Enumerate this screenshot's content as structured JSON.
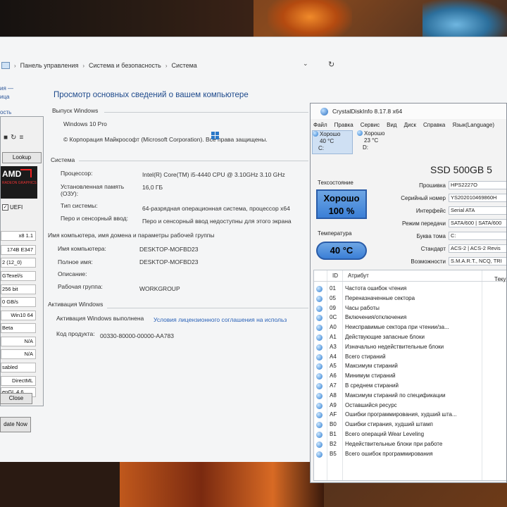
{
  "breadcrumb": [
    "Панель управления",
    "Система и безопасность",
    "Система"
  ],
  "nav_fragments": [
    "ия —",
    "ица",
    "ость"
  ],
  "system": {
    "title": "Просмотр основных сведений о вашем компьютере",
    "edition_header": "Выпуск Windows",
    "edition": "Windows 10 Pro",
    "copyright": "© Корпорация Майкрософт (Microsoft Corporation). Все права защищены.",
    "system_header": "Система",
    "processor_label": "Процессор:",
    "processor": "Intel(R) Core(TM) i5-4440 CPU @ 3.10GHz   3.10 GHz",
    "ram_label_1": "Установленная память",
    "ram_label_2": "(ОЗУ):",
    "ram": "16,0 ГБ",
    "type_label": "Тип системы:",
    "type": "64-разрядная операционная система, процессор x64",
    "pen_label": "Перо и сенсорный ввод:",
    "pen": "Перо и сенсорный ввод недоступны для этого экрана",
    "name_header": "Имя компьютера, имя домена и параметры рабочей группы",
    "computer_name_label": "Имя компьютера:",
    "computer_name": "DESKTOP-MOFBD23",
    "full_name_label": "Полное имя:",
    "full_name": "DESKTOP-MOFBD23",
    "description_label": "Описание:",
    "description": "",
    "workgroup_label": "Рабочая группа:",
    "workgroup": "WORKGROUP",
    "activation_header": "Активация Windows",
    "activation_status": "Активация Windows выполнена",
    "license_link": "Условия лицензионного соглашения на использ",
    "product_id_label": "Код продукта:",
    "product_id": "00330-80000-00000-AA783"
  },
  "gpuz": {
    "lookup": "Lookup",
    "logo_text": "AMD",
    "logo_sub": "RADEON GRAPHICS",
    "uefi": "UEFI",
    "fields": [
      "x8 1.1",
      "174B E347",
      "2 (12_0)",
      "GTexel/s",
      "256 bit",
      "0 GB/s",
      "Win10 64",
      "Beta",
      "N/A",
      "N/A",
      "sabled",
      "DirectML",
      "enGL 4.6"
    ],
    "close": "Close",
    "update": "date Now"
  },
  "cdi": {
    "title": "CrystalDiskInfo 8.17.8 x64",
    "menu": [
      "Файл",
      "Правка",
      "Сервис",
      "Вид",
      "Диск",
      "Справка",
      "Язык(Language)"
    ],
    "drives": [
      {
        "status": "Хорошо",
        "temp": "40 °C",
        "letter": "C:"
      },
      {
        "status": "Хорошо",
        "temp": "23 °C",
        "letter": "D:"
      }
    ],
    "model": "SSD 500GB 5",
    "health_label": "Техсостояние",
    "health_status": "Хорошо",
    "health_percent": "100 %",
    "temp_label": "Температура",
    "temp_value": "40 °C",
    "info": [
      {
        "label": "Прошивка",
        "value": "HPS2227O"
      },
      {
        "label": "Серийный номер",
        "value": "YS202010469860H"
      },
      {
        "label": "Интерфейс",
        "value": "Serial ATA"
      },
      {
        "label": "Режим передачи",
        "value": "SATA/600 | SATA/600"
      },
      {
        "label": "Буква тома",
        "value": "C:"
      },
      {
        "label": "Стандарт",
        "value": "ACS-2 | ACS-2 Revis"
      },
      {
        "label": "Возможности",
        "value": "S.M.A.R.T., NCQ, TRI"
      }
    ],
    "table_headers": {
      "id": "ID",
      "attr": "Атрибут",
      "current": "Теку"
    },
    "smart_rows": [
      {
        "id": "01",
        "name": "Частота ошибок чтения"
      },
      {
        "id": "05",
        "name": "Переназначенные сектора"
      },
      {
        "id": "09",
        "name": "Часы работы"
      },
      {
        "id": "0C",
        "name": "Включения/отключения"
      },
      {
        "id": "A0",
        "name": "Неисправимые сектора при чтении/за..."
      },
      {
        "id": "A1",
        "name": "Действующие запасные блоки"
      },
      {
        "id": "A3",
        "name": "Изначально недействительные блоки"
      },
      {
        "id": "A4",
        "name": "Всего стираний"
      },
      {
        "id": "A5",
        "name": "Максимум стираний"
      },
      {
        "id": "A6",
        "name": "Минимум стираний"
      },
      {
        "id": "A7",
        "name": "В среднем стираний"
      },
      {
        "id": "A8",
        "name": "Максимум стираний по спецификации"
      },
      {
        "id": "A9",
        "name": "Оставшийся ресурс"
      },
      {
        "id": "AF",
        "name": "Ошибки программирования, худший шта..."
      },
      {
        "id": "B0",
        "name": "Ошибки стирания, худший штамп"
      },
      {
        "id": "B1",
        "name": "Всего операций Wear Leveling"
      },
      {
        "id": "B2",
        "name": "Недействительные блоки при работе"
      },
      {
        "id": "B5",
        "name": "Всего ошибок программирования"
      }
    ]
  }
}
